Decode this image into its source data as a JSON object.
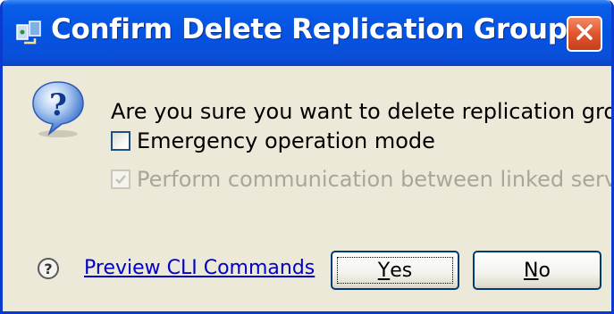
{
  "window": {
    "title": "Confirm Delete Replication Group"
  },
  "icons": {
    "app": "replication-app-icon",
    "close": "close-icon",
    "question": "question-icon",
    "help": "help-icon"
  },
  "dialog": {
    "message": "Are you sure you want to delete replication group 'test'?",
    "emergency": {
      "label": "Emergency operation mode",
      "checked": false,
      "enabled": true
    },
    "linked_servers": {
      "label": "Perform communication between linked servers",
      "checked": true,
      "enabled": false
    }
  },
  "footer": {
    "preview_link": "Preview CLI Commands",
    "yes_mnemonic": "Y",
    "yes_rest": "es",
    "no_mnemonic": "N",
    "no_rest": "o"
  },
  "colors": {
    "titlebar": "#0454e2",
    "dialog_bg": "#ece9d8",
    "link": "#0000c8",
    "close_button": "#e2552c",
    "disabled_text": "#a7a698"
  }
}
